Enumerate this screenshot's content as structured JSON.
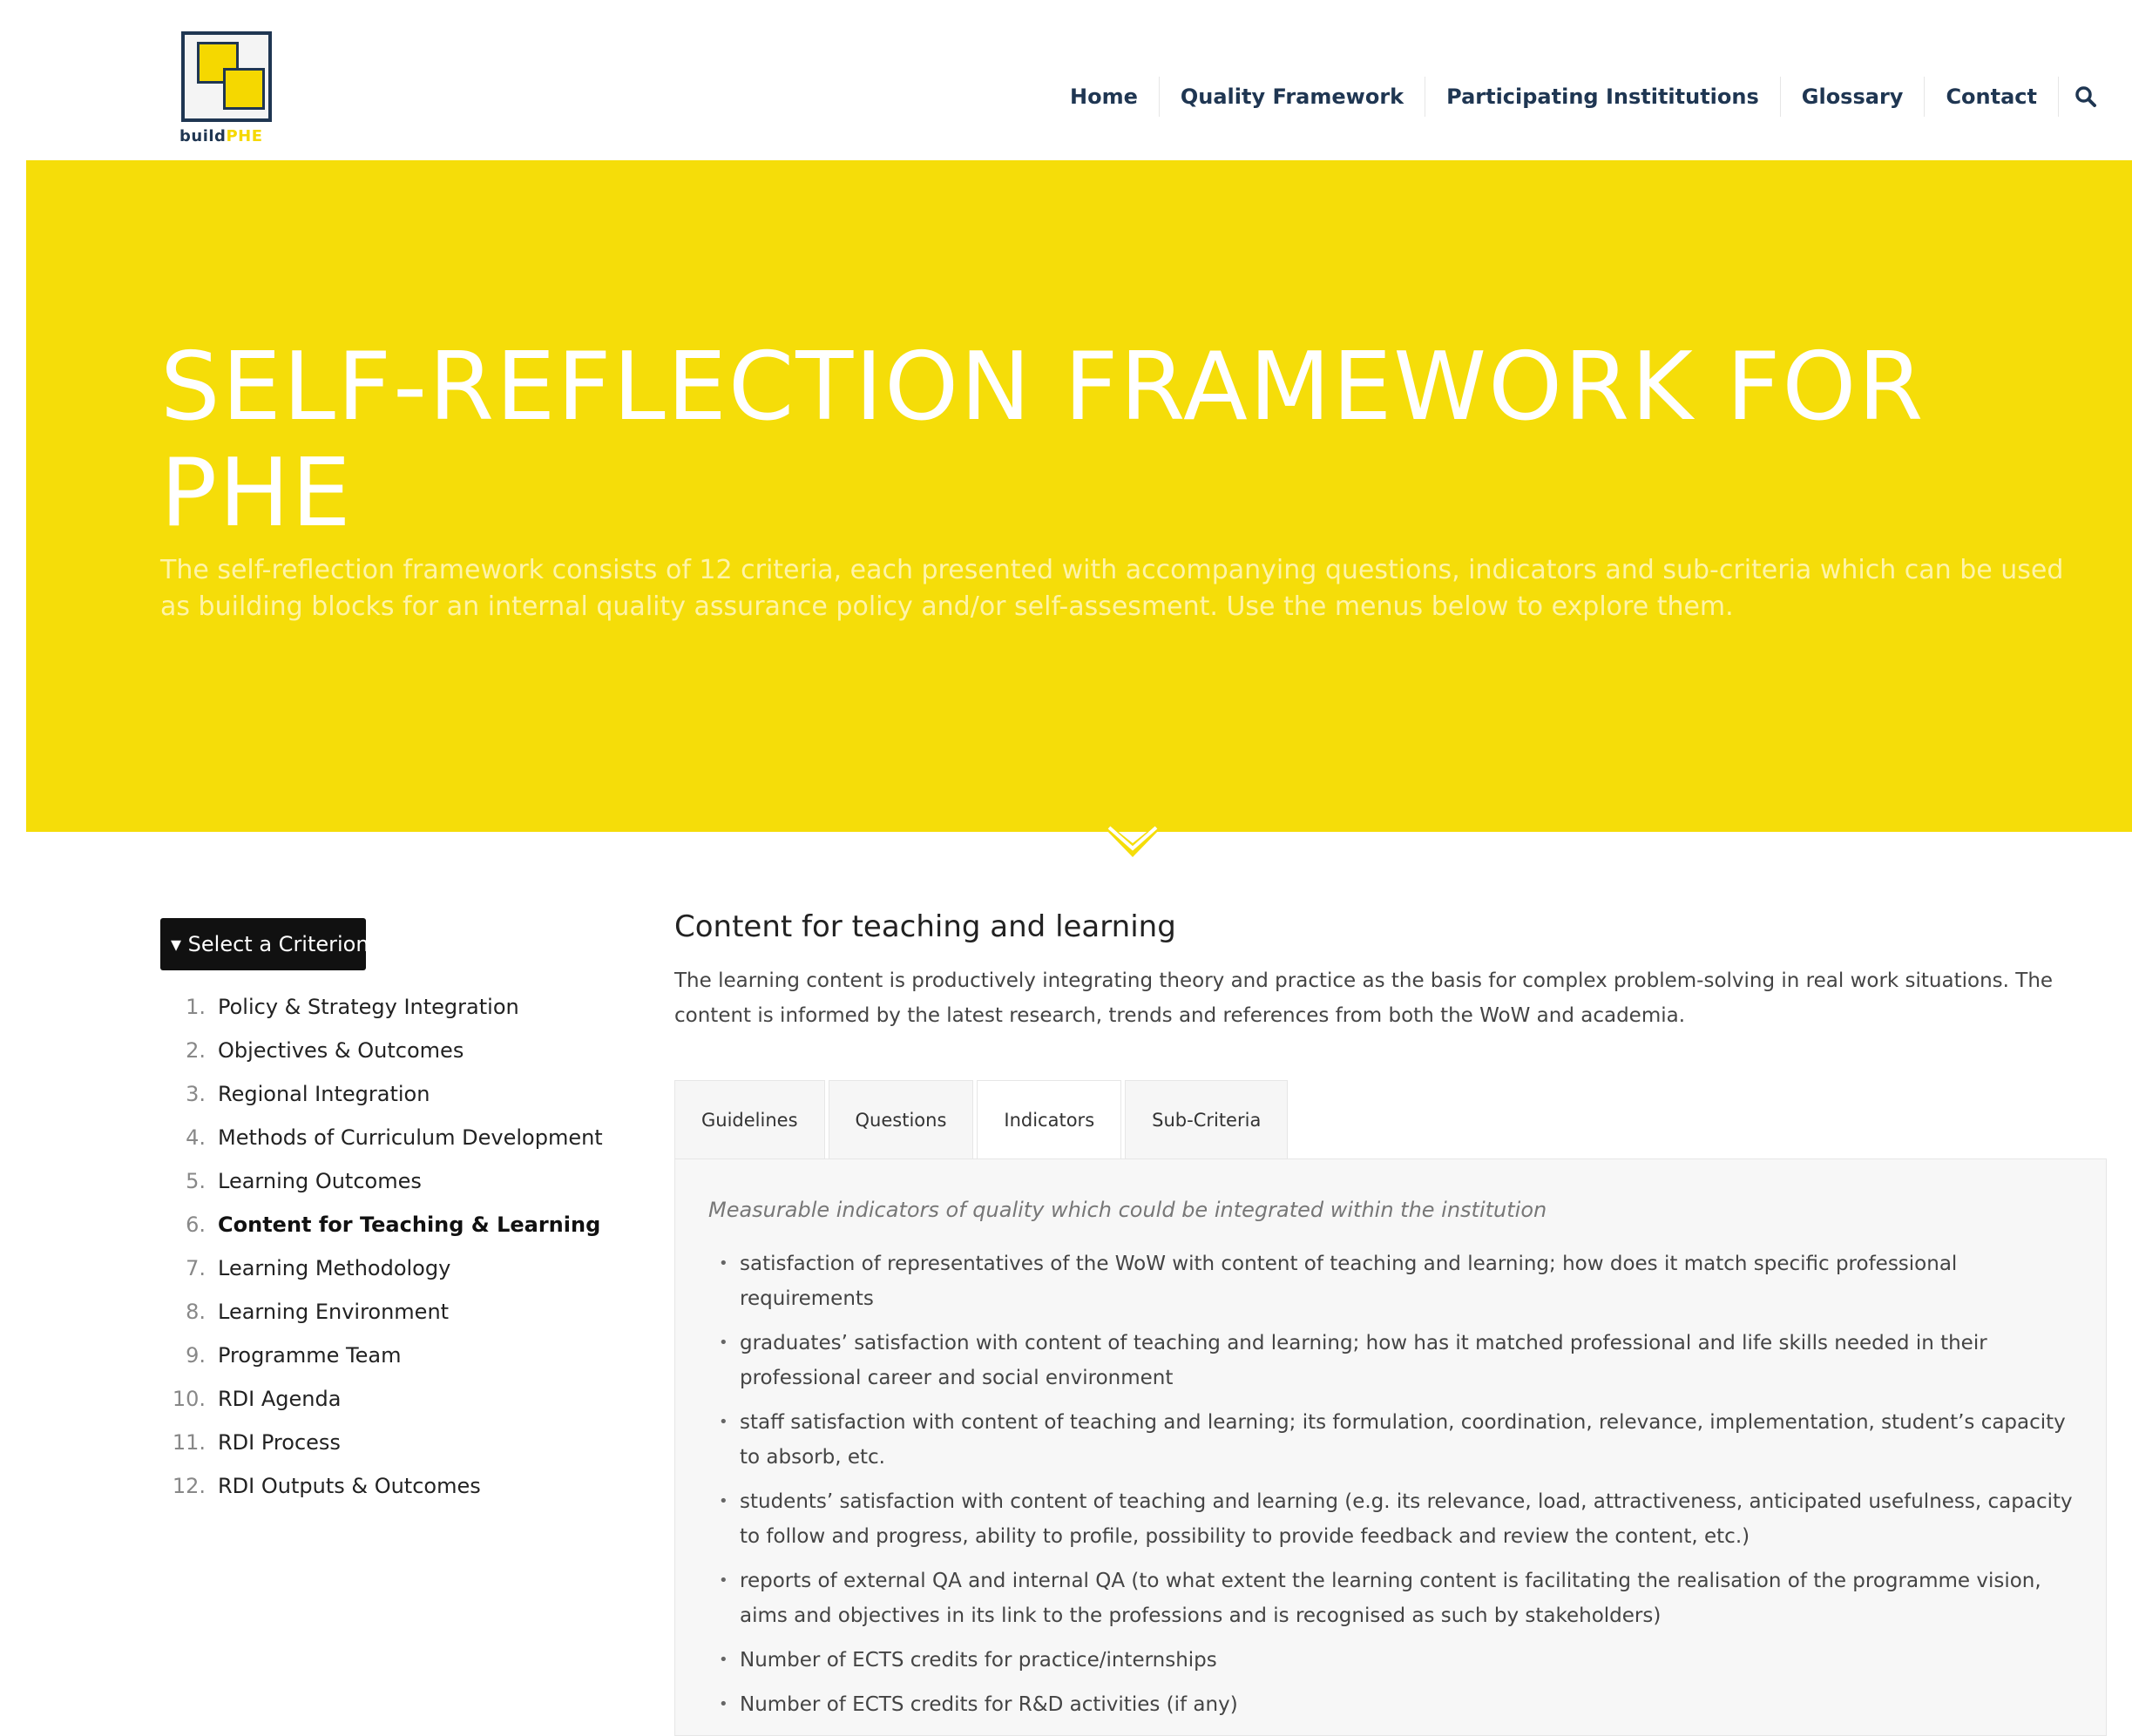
{
  "logo": {
    "text_main": "build",
    "text_accent": "PHE"
  },
  "nav": {
    "items": [
      {
        "label": "Home"
      },
      {
        "label": "Quality Framework"
      },
      {
        "label": "Participating Instititutions"
      },
      {
        "label": "Glossary"
      },
      {
        "label": "Contact"
      }
    ],
    "search_icon": "search-icon"
  },
  "hero": {
    "title": "SELF-REFLECTION FRAMEWORK FOR PHE",
    "subtitle": "The self-reflection framework consists of 12 criteria, each presented with accompanying questions, indicators and sub-criteria which can be used as building blocks for an internal quality assurance policy and/or self-assesment. Use the menus below to explore them.",
    "background_color": "#f5dd09",
    "scroll_icon": "chevron-down-icon"
  },
  "sidebar": {
    "button_label": "▾ Select a Criterion",
    "criteria": [
      {
        "num": "1.",
        "label": "Policy & Strategy Integration"
      },
      {
        "num": "2.",
        "label": "Objectives & Outcomes"
      },
      {
        "num": "3.",
        "label": "Regional Integration"
      },
      {
        "num": "4.",
        "label": "Methods of Curriculum Development"
      },
      {
        "num": "5.",
        "label": "Learning Outcomes"
      },
      {
        "num": "6.",
        "label": "Content for Teaching & Learning"
      },
      {
        "num": "7.",
        "label": "Learning Methodology"
      },
      {
        "num": "8.",
        "label": "Learning Environment"
      },
      {
        "num": "9.",
        "label": "Programme Team"
      },
      {
        "num": "10.",
        "label": "RDI Agenda"
      },
      {
        "num": "11.",
        "label": "RDI Process"
      },
      {
        "num": "12.",
        "label": "RDI Outputs & Outcomes"
      }
    ],
    "active_index": 5
  },
  "main": {
    "title": "Content for teaching and learning",
    "description": "The learning content is productively integrating theory and practice as the basis for complex problem-solving in real work situations. The content is informed by the latest research, trends and references from both the WoW and academia.",
    "tabs": [
      {
        "label": "Guidelines"
      },
      {
        "label": "Questions"
      },
      {
        "label": "Indicators"
      },
      {
        "label": "Sub-Criteria"
      }
    ],
    "active_tab": 2,
    "panel": {
      "intro": "Measurable indicators of quality which could be integrated within the institution",
      "items": [
        "satisfaction of representatives of the WoW with content of teaching and learning; how does it match specific professional requirements",
        "graduates’ satisfaction with content of teaching and learning; how has it matched professional and life skills needed in their professional career and social environment",
        "staff satisfaction with content of teaching and learning; its formulation, coordination, relevance, implementation, student’s capacity to absorb, etc.",
        "students’ satisfaction with content of teaching and learning (e.g. its relevance, load, attractiveness, anticipated usefulness, capacity to follow and progress, ability to profile, possibility to provide feedback and review the content, etc.)",
        "reports of external QA and internal QA (to what extent the learning content is facilitating the realisation of the programme vision, aims and objectives in its link to the professions and is recognised as such by stakeholders)",
        "Number of ECTS credits for practice/internships",
        "Number of ECTS credits for R&D activities (if any)"
      ]
    }
  }
}
